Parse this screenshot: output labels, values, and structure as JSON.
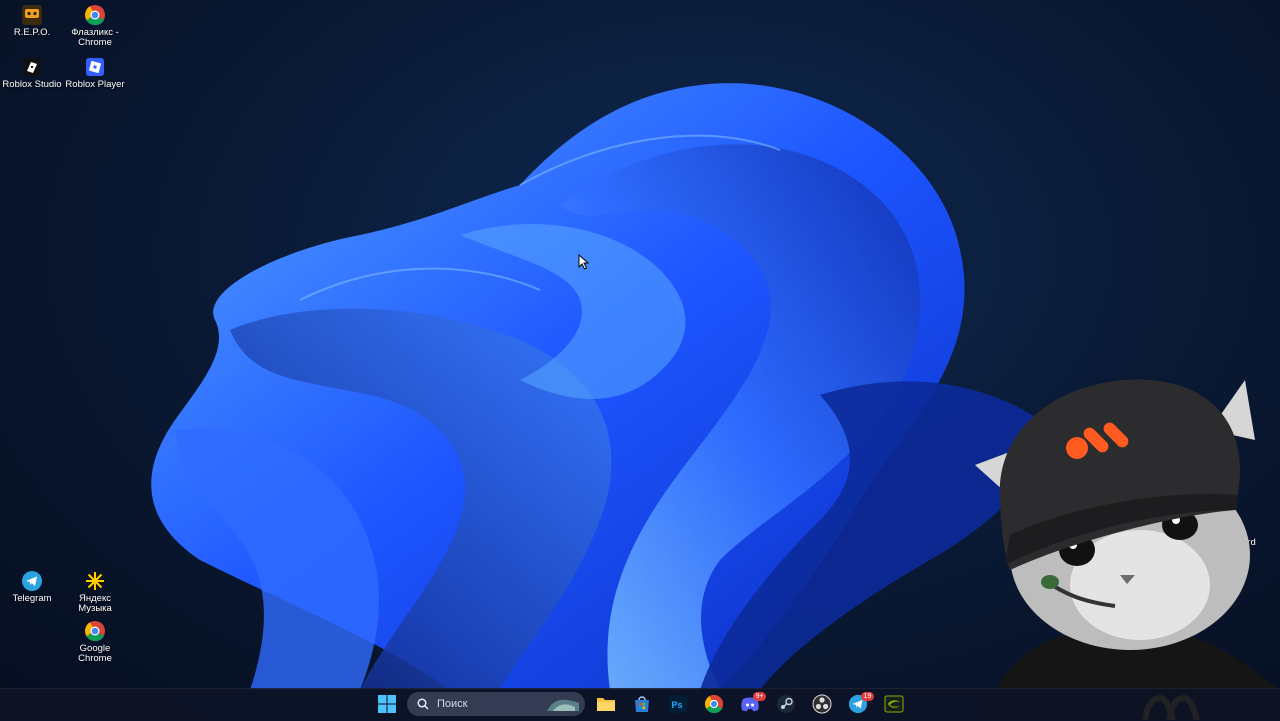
{
  "desktop": {
    "icons": [
      {
        "label": "R.E.P.O.",
        "icon": "repo-icon"
      },
      {
        "label": "Флазликс - Chrome",
        "icon": "chrome-icon"
      },
      {
        "label": "Roblox Studio",
        "icon": "roblox-studio-icon"
      },
      {
        "label": "Roblox Player",
        "icon": "roblox-player-icon"
      },
      {
        "label": "Telegram",
        "icon": "telegram-icon"
      },
      {
        "label": "Яндекс Музыка",
        "icon": "yandex-music-icon"
      },
      {
        "label": "Google Chrome",
        "icon": "chrome-icon"
      }
    ],
    "partial_icon_label": "ord"
  },
  "taskbar": {
    "search_placeholder": "Поиск",
    "apps": [
      {
        "name": "start",
        "icon": "windows-start-icon"
      },
      {
        "name": "file-explorer",
        "icon": "folder-icon"
      },
      {
        "name": "microsoft-store",
        "icon": "store-icon"
      },
      {
        "name": "photoshop",
        "icon": "photoshop-icon",
        "text": "Ps"
      },
      {
        "name": "chrome",
        "icon": "chrome-icon"
      },
      {
        "name": "discord",
        "icon": "discord-icon",
        "badge": "9+"
      },
      {
        "name": "steam",
        "icon": "steam-icon"
      },
      {
        "name": "obs",
        "icon": "obs-icon"
      },
      {
        "name": "telegram",
        "icon": "telegram-icon",
        "badge": "19"
      },
      {
        "name": "nvidia",
        "icon": "nvidia-icon"
      }
    ]
  },
  "colors": {
    "wallpaper_bg": "#0a1a36",
    "bloom_blue": "#1f5cff",
    "taskbar": "#0e1426",
    "badge": "#e23b3b",
    "cap_logo_orange": "#ff5a1f"
  }
}
